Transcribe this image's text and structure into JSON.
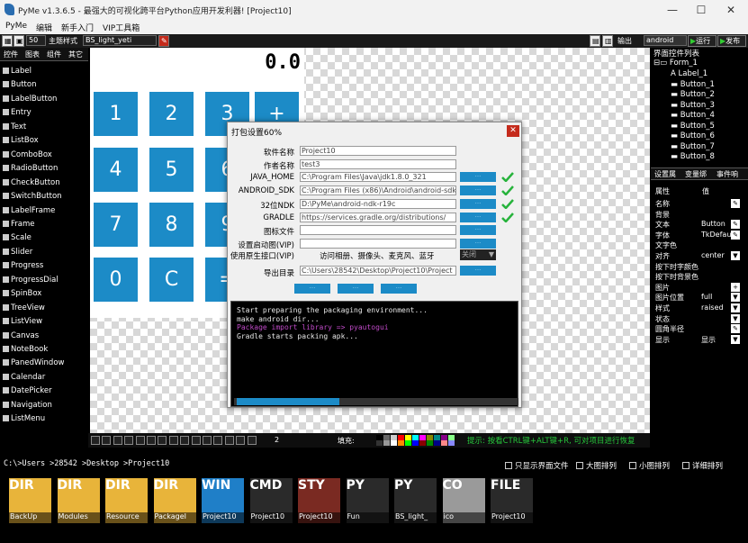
{
  "window": {
    "title": "PyMe v1.3.6.5 - 最强大的可视化跨平台Python应用开发利器!    [Project10]"
  },
  "menu": [
    "PyMe",
    "编辑",
    "新手入门",
    "VIP工具箱"
  ],
  "toolbar": {
    "size": "50",
    "theme_label": "主题样式",
    "theme_value": "BS_light_yeti",
    "output_label": "输出",
    "platform": "android",
    "run_label": "运行",
    "publish_label": "发布"
  },
  "left_tabs": [
    "控件",
    "图表",
    "组件",
    "其它"
  ],
  "controls": [
    "Label",
    "Button",
    "LabelButton",
    "Entry",
    "Text",
    "ListBox",
    "ComboBox",
    "RadioButton",
    "CheckButton",
    "SwitchButton",
    "LabelFrame",
    "Frame",
    "Scale",
    "Slider",
    "Progress",
    "ProgressDial",
    "SpinBox",
    "TreeView",
    "ListView",
    "Canvas",
    "NoteBook",
    "PanedWindow",
    "Calendar",
    "DatePicker",
    "Navigation",
    "ListMenu"
  ],
  "form": {
    "display": "0.0",
    "keys": [
      "1",
      "2",
      "3",
      "+",
      "4",
      "5",
      "6",
      "7",
      "8",
      "9",
      "0",
      "C",
      "="
    ],
    "key_color": "#1c8bc7"
  },
  "right_panel": {
    "title": "界面控件列表",
    "root": "Form_1",
    "items": [
      "Label_1",
      "Button_1",
      "Button_2",
      "Button_3",
      "Button_4",
      "Button_5",
      "Button_6",
      "Button_7",
      "Button_8"
    ],
    "tabs": [
      "设置属",
      "变量绑",
      "事件响"
    ],
    "prop_headers": [
      "属性",
      "值"
    ],
    "props": [
      {
        "k": "名称",
        "v": "",
        "b": "✎"
      },
      {
        "k": "背景",
        "v": "",
        "b": ""
      },
      {
        "k": "文本",
        "v": "Button",
        "b": "✎"
      },
      {
        "k": "字体",
        "v": "TkDefau",
        "b": "✎"
      },
      {
        "k": "文字色",
        "v": "",
        "b": ""
      },
      {
        "k": "对齐",
        "v": "center",
        "b": "▼"
      },
      {
        "k": "按下时字颜色",
        "v": "",
        "b": ""
      },
      {
        "k": "按下时背景色",
        "v": "",
        "b": ""
      },
      {
        "k": "图片",
        "v": "",
        "b": "+"
      },
      {
        "k": "图片位置",
        "v": "full",
        "b": "▼"
      },
      {
        "k": "样式",
        "v": "raised",
        "b": "▼"
      },
      {
        "k": "状态",
        "v": "",
        "b": "▼"
      },
      {
        "k": "圆角半径",
        "v": "",
        "b": "✎"
      },
      {
        "k": "显示",
        "v": "显示",
        "b": "▼"
      }
    ]
  },
  "dialog": {
    "title": "打包设置60%",
    "fields": [
      {
        "label": "软件名称",
        "value": "Project10",
        "btn": false,
        "tick": false
      },
      {
        "label": "作者名称",
        "value": "test3",
        "btn": false,
        "tick": false
      },
      {
        "label": "JAVA_HOME",
        "value": "C:\\Program Files\\Java\\jdk1.8.0_321",
        "btn": true,
        "tick": true
      },
      {
        "label": "ANDROID_SDK",
        "value": "C:\\Program Files (x86)\\Android\\android-sdk",
        "btn": true,
        "tick": true
      },
      {
        "label": "32位NDK",
        "value": "D:\\PyMe\\android-ndk-r19c",
        "btn": true,
        "tick": true
      },
      {
        "label": "GRADLE",
        "value": "https://services.gradle.org/distributions/",
        "btn": true,
        "tick": true
      },
      {
        "label": "图标文件",
        "value": "",
        "btn": true,
        "tick": false
      },
      {
        "label": "设置启动图(VIP)",
        "value": "",
        "btn": true,
        "tick": false
      }
    ],
    "native_label": "使用原生接口(VIP)",
    "native_value": "访问相册、摄像头、麦克风、蓝牙",
    "native_state": "关闭",
    "export_label": "导出目录",
    "export_value": "C:\\Users\\28542\\Desktop\\Project10\\Project",
    "console": [
      {
        "text": "Start preparing the packaging environment...",
        "color": "#e8e8e8"
      },
      {
        "text": "make android dir...",
        "color": "#e8e8e8"
      },
      {
        "text": "Package import library => pyautogui",
        "color": "#c04ac8"
      },
      {
        "text": "Gradle starts packing apk...",
        "color": "#e8e8e8"
      }
    ],
    "progress": 0.6
  },
  "bottom": {
    "line_width": "2",
    "fill_label": "填充:",
    "hint": "提示: 按看CTRL键+ALT键+R, 可对项目进行恢复"
  },
  "path": {
    "text": "C:\\>Users >28542 >Desktop >Project10",
    "options": [
      "只显示界面文件",
      "大图排列",
      "小图排列",
      "详细排列"
    ]
  },
  "files": [
    {
      "top": "DIR",
      "label": "BackUp",
      "color": "#e8b43a"
    },
    {
      "top": "DIR",
      "label": "Modules",
      "color": "#e8b43a"
    },
    {
      "top": "DIR",
      "label": "Resource",
      "color": "#e8b43a"
    },
    {
      "top": "DIR",
      "label": "PackageI",
      "color": "#e8b43a"
    },
    {
      "top": "WIN",
      "label": "Project10",
      "color": "#1f7fc8"
    },
    {
      "top": "CMD",
      "label": "Project10",
      "color": "#2a2a2a"
    },
    {
      "top": "STY",
      "label": "Project10",
      "color": "#7a2a22"
    },
    {
      "top": "PY",
      "label": "Fun",
      "color": "#2a2a2a"
    },
    {
      "top": "PY",
      "label": "BS_light_",
      "color": "#2a2a2a"
    },
    {
      "top": "CO",
      "label": "ico",
      "color": "#9a9a9a"
    },
    {
      "top": "FILE",
      "label": "Project10",
      "color": "#2a2a2a"
    }
  ]
}
